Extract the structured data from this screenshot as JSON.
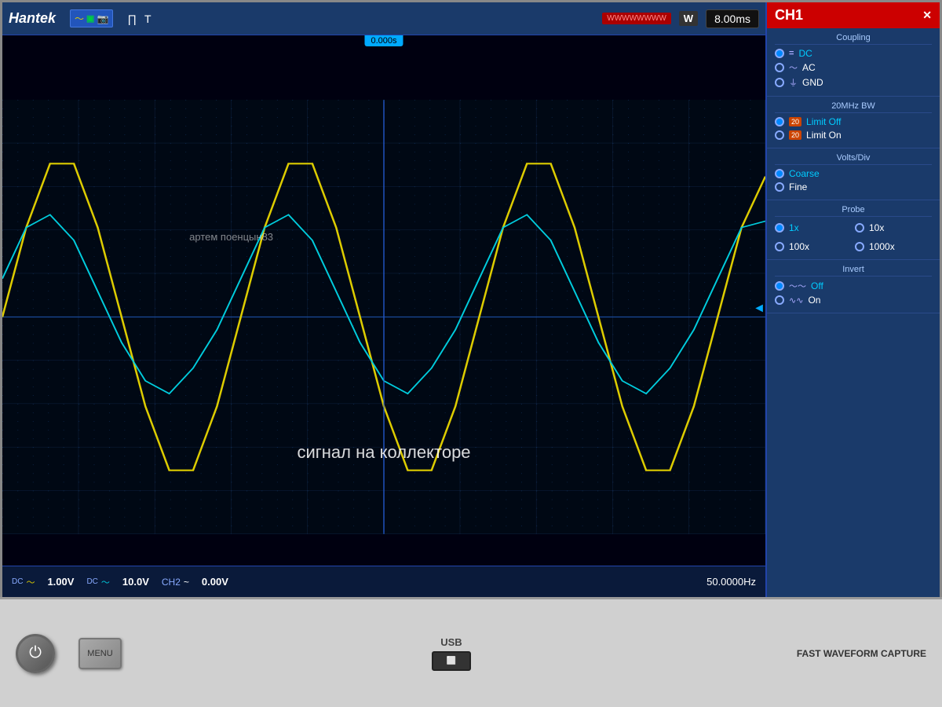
{
  "header": {
    "brand": "Hantek",
    "trigger_label": "T",
    "w_label": "W",
    "time_per_div": "8.00ms",
    "ch1_label": "CH1",
    "time_position": "0.000s"
  },
  "status_bar": {
    "ch1_coupling": "DC",
    "ch1_voltage": "1.00V",
    "ch2_coupling": "DC",
    "ch2_voltage": "10.0V",
    "ch2_label": "CH2",
    "ch2_wave": "~",
    "ch2_offset": "0.00V",
    "frequency": "50.0000Hz"
  },
  "right_panel": {
    "channel": "CH1",
    "coupling_title": "Coupling",
    "coupling_options": [
      {
        "label": "DC",
        "selected": true,
        "prefix": "="
      },
      {
        "label": "AC",
        "selected": false,
        "prefix": "~"
      },
      {
        "label": "GND",
        "selected": false,
        "prefix": "+"
      }
    ],
    "bw_title": "20MHz BW",
    "bw_options": [
      {
        "label": "Limit Off",
        "selected": true
      },
      {
        "label": "Limit On",
        "selected": false
      }
    ],
    "volts_div_title": "Volts/Div",
    "volts_options": [
      {
        "label": "Coarse",
        "selected": true
      },
      {
        "label": "Fine",
        "selected": false
      }
    ],
    "probe_title": "Probe",
    "probe_options": [
      {
        "label": "1x",
        "selected": true
      },
      {
        "label": "10x",
        "selected": false
      },
      {
        "label": "100x",
        "selected": false
      },
      {
        "label": "1000x",
        "selected": false
      }
    ],
    "invert_title": "Invert",
    "invert_options": [
      {
        "label": "Off",
        "selected": true
      },
      {
        "label": "On",
        "selected": false
      }
    ]
  },
  "display": {
    "watermark": "артем поенцын83",
    "signal_label": "сигнал на коллекторе"
  },
  "bottom": {
    "usb_label": "USB",
    "fast_waveform_label": "FAST WAVEFORM CAPTURE"
  }
}
